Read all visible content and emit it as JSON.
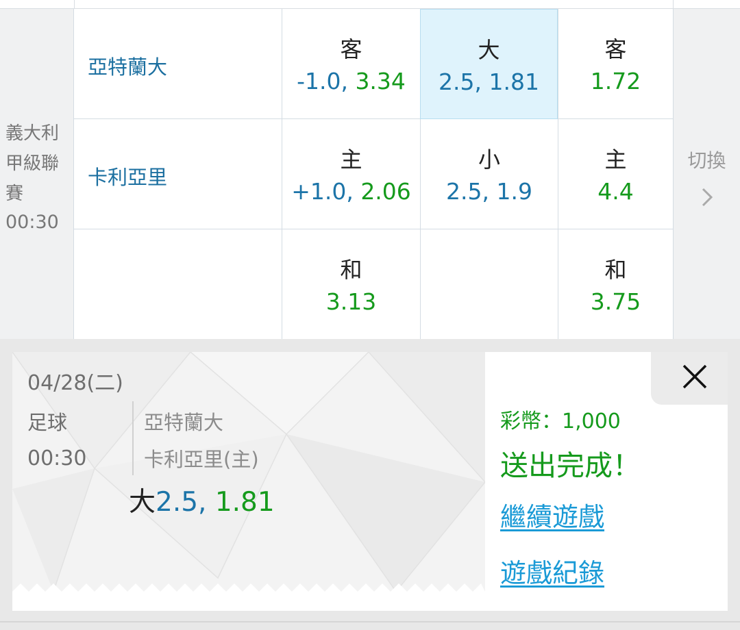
{
  "league": {
    "name": "義大利甲級聯賽",
    "time": "00:30"
  },
  "teams": {
    "away": "亞特蘭大",
    "home": "卡利亞里"
  },
  "odds": {
    "r1c1": {
      "label": "客",
      "handicap": "-1.0, ",
      "price": "3.34"
    },
    "r1c2": {
      "label": "大",
      "line": "2.5, 1.81",
      "selected": true
    },
    "r1c3": {
      "label": "客",
      "price": "1.72"
    },
    "r2c1": {
      "label": "主",
      "handicap": "+1.0, ",
      "price": "2.06"
    },
    "r2c2": {
      "label": "小",
      "line": "2.5, 1.9"
    },
    "r2c3": {
      "label": "主",
      "price": "4.4"
    },
    "r3c1": {
      "label": "和",
      "price": "3.13"
    },
    "r3c3": {
      "label": "和",
      "price": "3.75"
    }
  },
  "switch": {
    "label": "切換",
    "icon": "chevron-right-icon"
  },
  "receipt": {
    "date": "04/28(二)",
    "sport": "足球",
    "time": "00:30",
    "away_team": "亞特蘭大",
    "home_team": "卡利亞里(主)",
    "bet_type": "大",
    "bet_line": "2.5, ",
    "bet_price": "1.81"
  },
  "result": {
    "coins": "彩幣：1,000",
    "status": "送出完成！",
    "continue_link": "繼續遊戲",
    "history_link": "遊戲紀錄",
    "close_icon": "close-icon"
  },
  "colors": {
    "team_blue": "#1b6fa0",
    "odds_blue": "#1c74a8",
    "odds_green": "#159a1c",
    "selected_bg": "#dff3fc",
    "link_blue": "#1a9ad6"
  }
}
